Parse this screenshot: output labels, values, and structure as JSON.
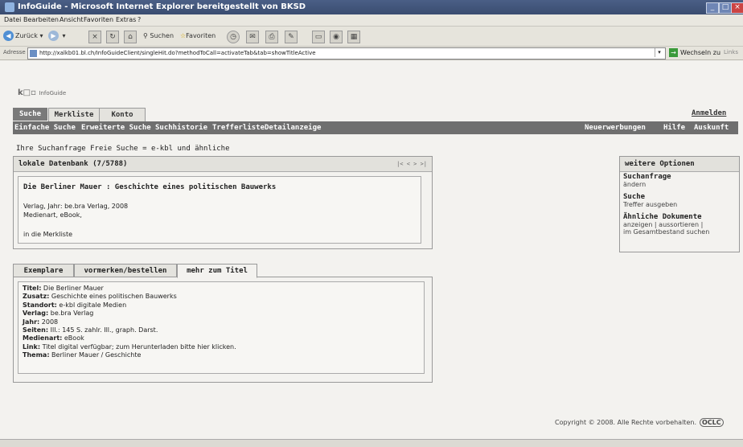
{
  "window": {
    "title": "InfoGuide - Microsoft Internet Explorer bereitgestellt von BKSD"
  },
  "menu": [
    "Datei",
    "Bearbeiten",
    "Ansicht",
    "Favoriten",
    "Extras",
    "?"
  ],
  "toolbar": {
    "back": "Zurück",
    "search": "Suchen",
    "favorites": "Favoriten"
  },
  "address": {
    "label": "Adresse",
    "url": "http://xalkb01.bl.ch/InfoGuideClient/singleHit.do?methodToCall=activateTab&tab=showTitleActive",
    "go": "Wechseln zu",
    "links": "Links"
  },
  "logo": {
    "text": "k",
    "sub": "InfoGuide"
  },
  "tabs": [
    "Suche",
    "Merkliste",
    "Konto"
  ],
  "login": "Anmelden",
  "subnav_left": [
    "Einfache Suche",
    "Erweiterte Suche",
    "Suchhistorie",
    "Trefferliste",
    "Detailanzeige"
  ],
  "subnav_right": [
    "Neuerwerbungen",
    "Hilfe",
    "Auskunft"
  ],
  "query": "Ihre Suchanfrage Freie Suche = e-kbl und ähnliche",
  "result": {
    "header": "lokale Datenbank (7/5788)",
    "pager": "|< < > >|",
    "title": "Die Berliner Mauer : Geschichte eines politischen Bauwerks",
    "publisher": "Verlag, Jahr: be.bra Verlag, 2008",
    "media": "Medienart, eBook,",
    "watchlist": "in die Merkliste"
  },
  "options": {
    "header": "weitere Optionen",
    "items": [
      {
        "head": "Suchanfrage",
        "links": "ändern"
      },
      {
        "head": "Suche",
        "links": "Treffer ausgeben"
      },
      {
        "head": "Ähnliche Dokumente",
        "links": "anzeigen | aussortieren |",
        "links2": "im Gesamtbestand suchen"
      }
    ]
  },
  "detail_tabs": [
    "Exemplare",
    "vormerken/bestellen",
    "mehr zum Titel"
  ],
  "detail": [
    {
      "label": "Titel:",
      "value": " Die Berliner Mauer"
    },
    {
      "label": "Zusatz:",
      "value": " Geschichte eines politischen Bauwerks"
    },
    {
      "label": "Standort:",
      "value": " e-kbl digitale Medien"
    },
    {
      "label": "Verlag:",
      "value": " be.bra Verlag"
    },
    {
      "label": "Jahr:",
      "value": " 2008"
    },
    {
      "label": "Seiten:",
      "value": " Ill.: 145 S. zahlr. Ill., graph. Darst."
    },
    {
      "label": "Medienart:",
      "value": " eBook"
    },
    {
      "label": "Link:",
      "value": " Titel digital verfügbar; zum Herunterladen bitte hier klicken."
    },
    {
      "label": "Thema:",
      "value": " Berliner Mauer / Geschichte"
    }
  ],
  "footer": {
    "copyright": "Copyright © 2008. Alle Rechte vorbehalten.",
    "oclc": "OCLC"
  }
}
